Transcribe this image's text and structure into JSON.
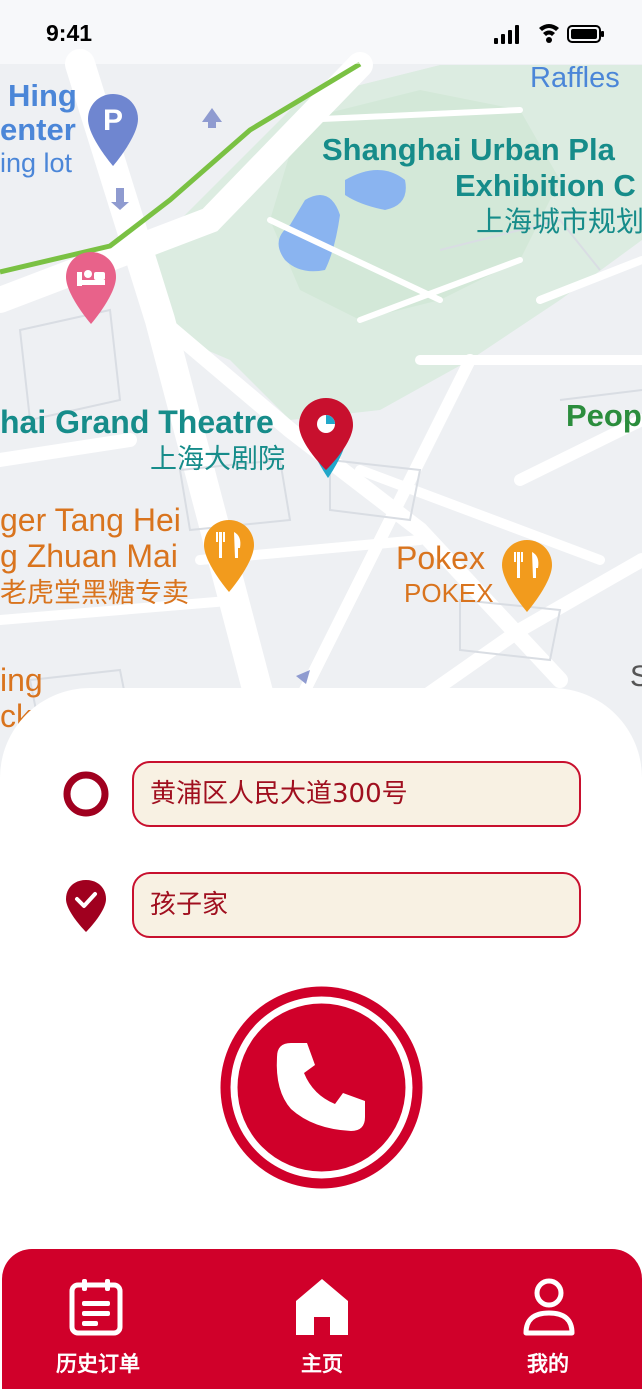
{
  "status_bar": {
    "time": "9:41"
  },
  "map": {
    "labels": {
      "hing_center_1": "Hing",
      "hing_center_2": "enter",
      "hing_center_3": "ing lot",
      "raffles": "Raffles",
      "urban_plan_1": "Shanghai Urban Pla",
      "urban_plan_2": "Exhibition C",
      "urban_plan_cn": "上海城市规划",
      "grand_theatre": "hai Grand Theatre",
      "grand_theatre_cn": "上海大剧院",
      "people": "Peop",
      "tiger_1": "ger Tang Hei",
      "tiger_2": "g Zhuan Mai",
      "tiger_cn": "老虎堂黑糖专卖",
      "pokex": "Pokex",
      "pokex_sub": "POKEX",
      "left_1": "ing",
      "left_2": "cks",
      "right_s": "S"
    }
  },
  "trip": {
    "origin": "黄浦区人民大道300号",
    "destination": "孩子家"
  },
  "tabs": [
    {
      "label": "历史订单",
      "icon": "order-history-icon"
    },
    {
      "label": "主页",
      "icon": "home-icon"
    },
    {
      "label": "我的",
      "icon": "profile-icon"
    }
  ],
  "colors": {
    "brand": "#d0002a",
    "field_bg": "#f8f1e3"
  }
}
